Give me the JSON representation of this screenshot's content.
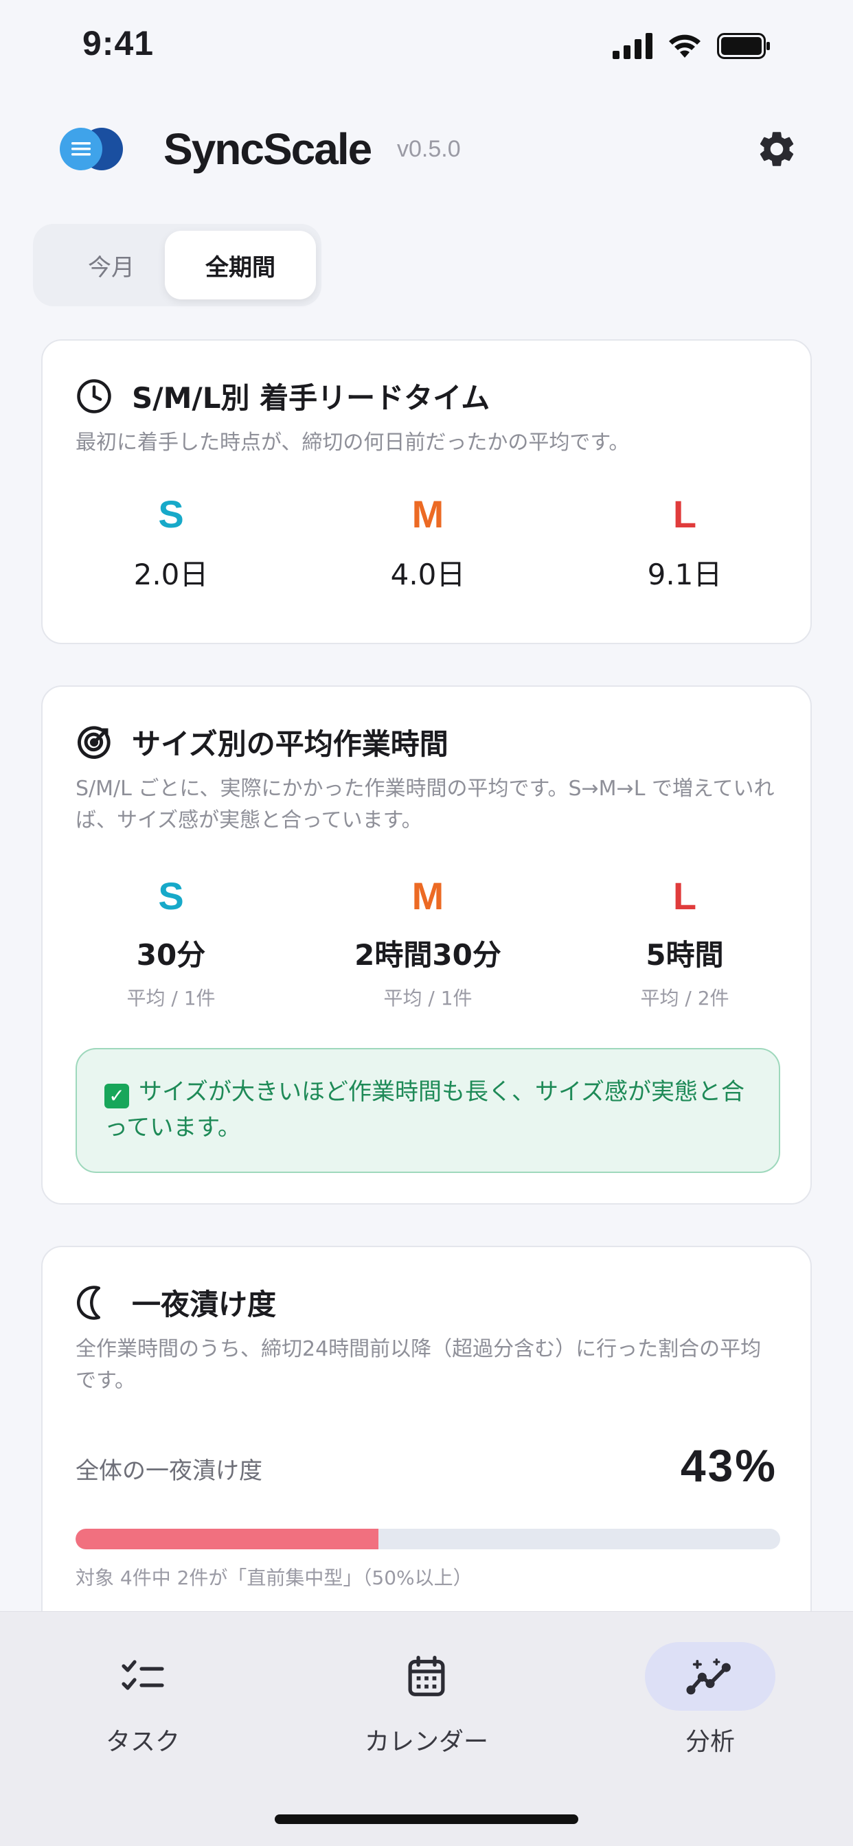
{
  "status_bar": {
    "time": "9:41"
  },
  "header": {
    "app_name": "SyncScale",
    "version": "v0.5.0"
  },
  "period_tabs": [
    {
      "label": "今月",
      "selected": false
    },
    {
      "label": "全期間",
      "selected": true
    }
  ],
  "lead_time_card": {
    "title": "S/M/L別 着手リードタイム",
    "description": "最初に着手した時点が、締切の何日前だったかの平均です。",
    "items": [
      {
        "size": "S",
        "value": "2.0日"
      },
      {
        "size": "M",
        "value": "4.0日"
      },
      {
        "size": "L",
        "value": "9.1日"
      }
    ]
  },
  "work_time_card": {
    "title": "サイズ別の平均作業時間",
    "description": "S/M/L ごとに、実際にかかった作業時間の平均です。S→M→L で増えていれば、サイズ感が実態と合っています。",
    "items": [
      {
        "size": "S",
        "value": "30分",
        "sub": "平均 / 1件"
      },
      {
        "size": "M",
        "value": "2時間30分",
        "sub": "平均 / 1件"
      },
      {
        "size": "L",
        "value": "5時間",
        "sub": "平均 / 2件"
      }
    ],
    "notice": "サイズが大きいほど作業時間も長く、サイズ感が実態と合っています。"
  },
  "overnight_card": {
    "title": "一夜漬け度",
    "description": "全作業時間のうち、締切24時間前以降（超過分含む）に行った割合の平均です。",
    "overall_label": "全体の一夜漬け度",
    "overall_value": "43%",
    "progress": 0.43,
    "caption": "対象 4件中 2件が「直前集中型」（50%以上）"
  },
  "tab_bar": [
    {
      "label": "タスク",
      "icon": "checklist-icon",
      "active": false
    },
    {
      "label": "カレンダー",
      "icon": "calendar-icon",
      "active": false
    },
    {
      "label": "分析",
      "icon": "analytics-icon",
      "active": true
    }
  ],
  "colors": {
    "size_s": "#17a9c9",
    "size_m": "#ec6a24",
    "size_l": "#e03c3c",
    "progress_fill": "#f1707f",
    "success_text": "#1e8a57"
  }
}
